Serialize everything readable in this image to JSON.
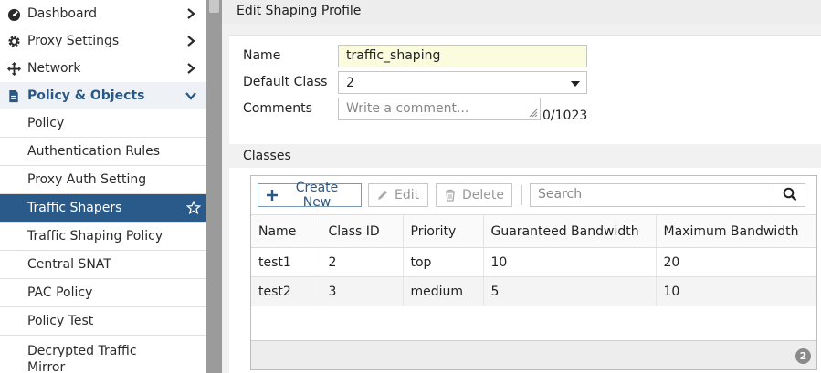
{
  "sidebar": {
    "top_items": [
      {
        "label": "Dashboard",
        "icon": "dashboard-icon"
      },
      {
        "label": "Proxy Settings",
        "icon": "gear-icon"
      },
      {
        "label": "Network",
        "icon": "network-move-icon"
      }
    ],
    "expanded": {
      "label": "Policy & Objects",
      "icon": "document-icon"
    },
    "sub_items": [
      "Policy",
      "Authentication Rules",
      "Proxy Auth Setting",
      "Traffic Shapers",
      "Traffic Shaping Policy",
      "Central SNAT",
      "PAC Policy",
      "Policy Test",
      "Decrypted Traffic Mirror"
    ],
    "active_item": "Traffic Shapers"
  },
  "page": {
    "title": "Edit Shaping Profile"
  },
  "form": {
    "name_label": "Name",
    "name_value": "traffic_shaping",
    "default_class_label": "Default Class",
    "default_class_value": "2",
    "comments_label": "Comments",
    "comments_placeholder": "Write a comment...",
    "char_count": "0/1023"
  },
  "classes": {
    "header": "Classes",
    "toolbar": {
      "create_label": "Create New",
      "edit_label": "Edit",
      "delete_label": "Delete",
      "search_placeholder": "Search"
    },
    "columns": [
      "Name",
      "Class ID",
      "Priority",
      "Guaranteed Bandwidth",
      "Maximum Bandwidth"
    ],
    "rows": [
      [
        "test1",
        "2",
        "top",
        "10",
        "20"
      ],
      [
        "test2",
        "3",
        "medium",
        "5",
        "10"
      ]
    ],
    "count": "2"
  },
  "colors": {
    "active_nav": "#2a5a8a",
    "accent": "#2a5885",
    "name_field_bg": "#fbfbdd"
  }
}
